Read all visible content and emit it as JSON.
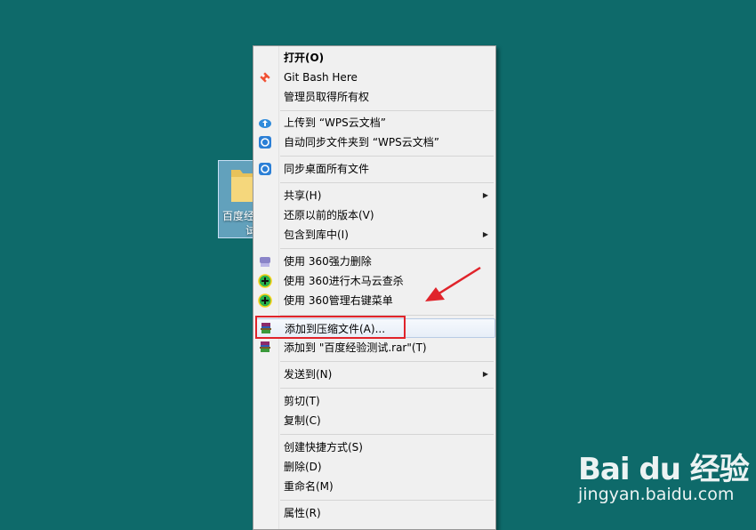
{
  "desktop": {
    "folder": {
      "label_line1": "百度经",
      "label_line2": "试"
    }
  },
  "menu": {
    "items": [
      {
        "label": "打开(O)",
        "bold": true,
        "icon": "none"
      },
      {
        "label": "Git Bash Here",
        "icon": "git-icon"
      },
      {
        "label": "管理员取得所有权",
        "icon": "none"
      },
      {
        "label": "上传到 “WPS云文档”",
        "icon": "cloud-upload-icon"
      },
      {
        "label": "自动同步文件夹到 “WPS云文档”",
        "icon": "sync-icon"
      },
      {
        "label": "同步桌面所有文件",
        "icon": "sync-icon"
      },
      {
        "label": "共享(H)",
        "icon": "none",
        "submenu": true
      },
      {
        "label": "还原以前的版本(V)",
        "icon": "none"
      },
      {
        "label": "包含到库中(I)",
        "icon": "none",
        "submenu": true
      },
      {
        "label": "使用 360强力删除",
        "icon": "shredder-icon"
      },
      {
        "label": "使用 360进行木马云查杀",
        "icon": "360-icon"
      },
      {
        "label": "使用 360管理右键菜单",
        "icon": "360-icon"
      },
      {
        "label": "添加到压缩文件(A)...",
        "icon": "winrar-icon",
        "hover": true
      },
      {
        "label": "添加到 \"百度经验测试.rar\"(T)",
        "icon": "winrar-icon"
      },
      {
        "label": "发送到(N)",
        "icon": "none",
        "submenu": true
      },
      {
        "label": "剪切(T)",
        "icon": "none"
      },
      {
        "label": "复制(C)",
        "icon": "none"
      },
      {
        "label": "创建快捷方式(S)",
        "icon": "none"
      },
      {
        "label": "删除(D)",
        "icon": "none"
      },
      {
        "label": "重命名(M)",
        "icon": "none"
      },
      {
        "label": "属性(R)",
        "icon": "none"
      }
    ],
    "submenu_arrow": "▶"
  },
  "watermark": {
    "logo": "Bai du 经验",
    "sub": "jingyan.baidu.com"
  },
  "colors": {
    "desktop": "#0e6a6a",
    "menu_bg": "#f0f0f0",
    "highlight": "#e0242b"
  }
}
